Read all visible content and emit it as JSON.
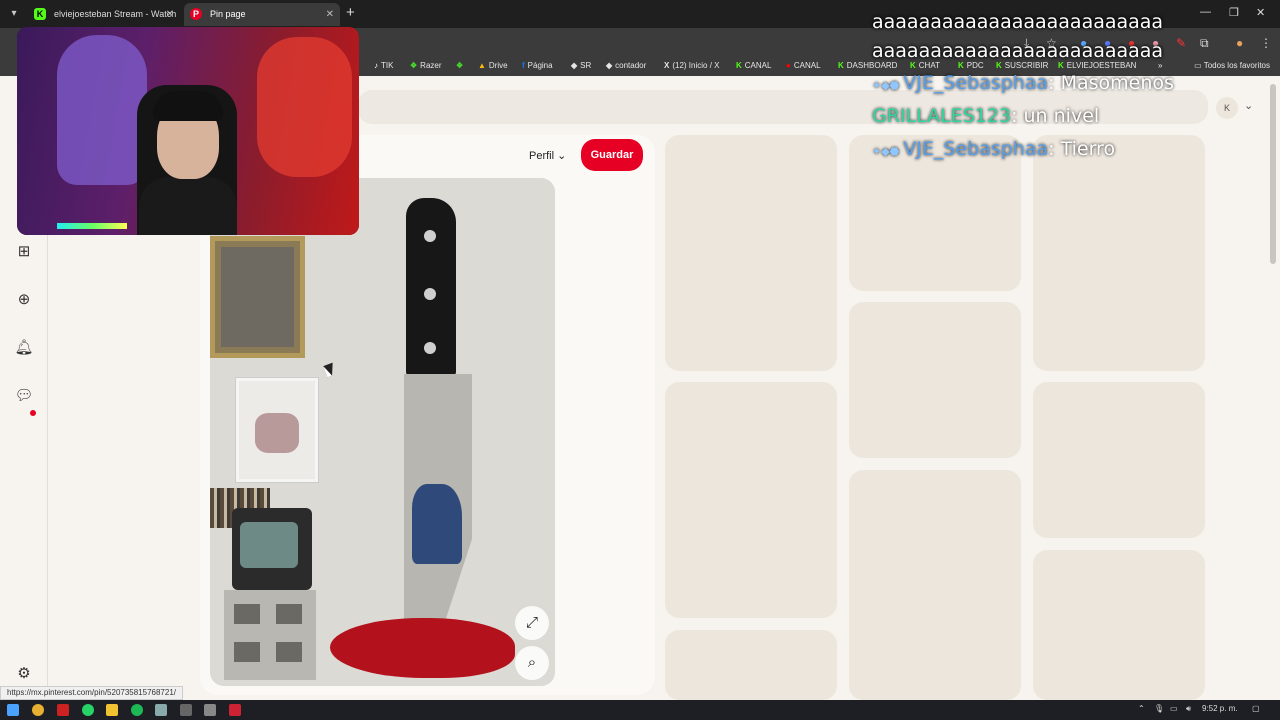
{
  "browser": {
    "tabs": [
      {
        "title": "elviejoesteban Stream - Watch",
        "favicon": "K"
      },
      {
        "title": "Pin page",
        "favicon": "P"
      }
    ],
    "bookmarks": [
      {
        "label": "TIK",
        "icon": "tiktok-icon"
      },
      {
        "label": "Razer",
        "icon": "razer-icon"
      },
      {
        "label": "Drive",
        "icon": "drive-icon"
      },
      {
        "label": "Página",
        "icon": "facebook-icon"
      },
      {
        "label": "SR",
        "icon": "sr-icon"
      },
      {
        "label": "contador",
        "icon": "contador-icon"
      },
      {
        "label": "(12) Inicio / X",
        "icon": "x-icon"
      },
      {
        "label": "CANAL",
        "icon": "kick-icon"
      },
      {
        "label": "CANAL",
        "icon": "youtube-icon"
      },
      {
        "label": "DASHBOARD",
        "icon": "kick-icon"
      },
      {
        "label": "CHAT",
        "icon": "kick-icon"
      },
      {
        "label": "PDC",
        "icon": "kick-icon"
      },
      {
        "label": "SUSCRIBIR",
        "icon": "kick-icon"
      },
      {
        "label": "ELVIEJOESTEBAN",
        "icon": "kick-icon"
      }
    ],
    "all_bookmarks": "Todos los favoritos",
    "status_url": "https://mx.pinterest.com/pin/520735815768721/"
  },
  "pinterest": {
    "avatar_initial": "K",
    "perfil_label": "Perfil",
    "save_label": "Guardar",
    "accent": "#e60023"
  },
  "chat": {
    "spam": [
      "aaaaaaaaaaaaaaaaaaaaaaaaa",
      "aaaaaaaaaaaaaaaaaaaaaaaaa"
    ],
    "messages": [
      {
        "user": "VJE_Sebasphaa",
        "text": "Masomenos"
      },
      {
        "user": "GRILLALES123",
        "text": "un nivel"
      },
      {
        "user": "VJE_Sebasphaa",
        "text": "Tierro"
      }
    ]
  },
  "taskbar": {
    "time": "9:52 p. m."
  }
}
